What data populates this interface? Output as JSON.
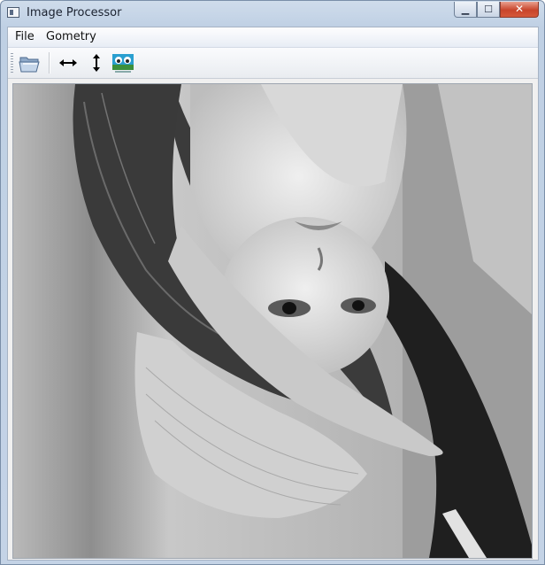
{
  "window": {
    "title": "Image Processor",
    "minimize_glyph": "▁",
    "maximize_glyph": "☐",
    "close_glyph": "✕"
  },
  "menubar": {
    "items": [
      {
        "label": "File"
      },
      {
        "label": "Gometry"
      }
    ]
  },
  "toolbar": {
    "buttons": [
      {
        "name": "open-folder-icon"
      },
      {
        "name": "flip-horizontal-icon"
      },
      {
        "name": "flip-vertical-icon"
      },
      {
        "name": "image-effects-icon"
      }
    ]
  },
  "canvas": {
    "image": "grayscale-portrait-photo-flipped",
    "colors": {
      "background": "#dcdcdc",
      "skin": "#e6e6e6",
      "hat": "#d0d0d0",
      "feather": "#3a3a3a"
    }
  }
}
